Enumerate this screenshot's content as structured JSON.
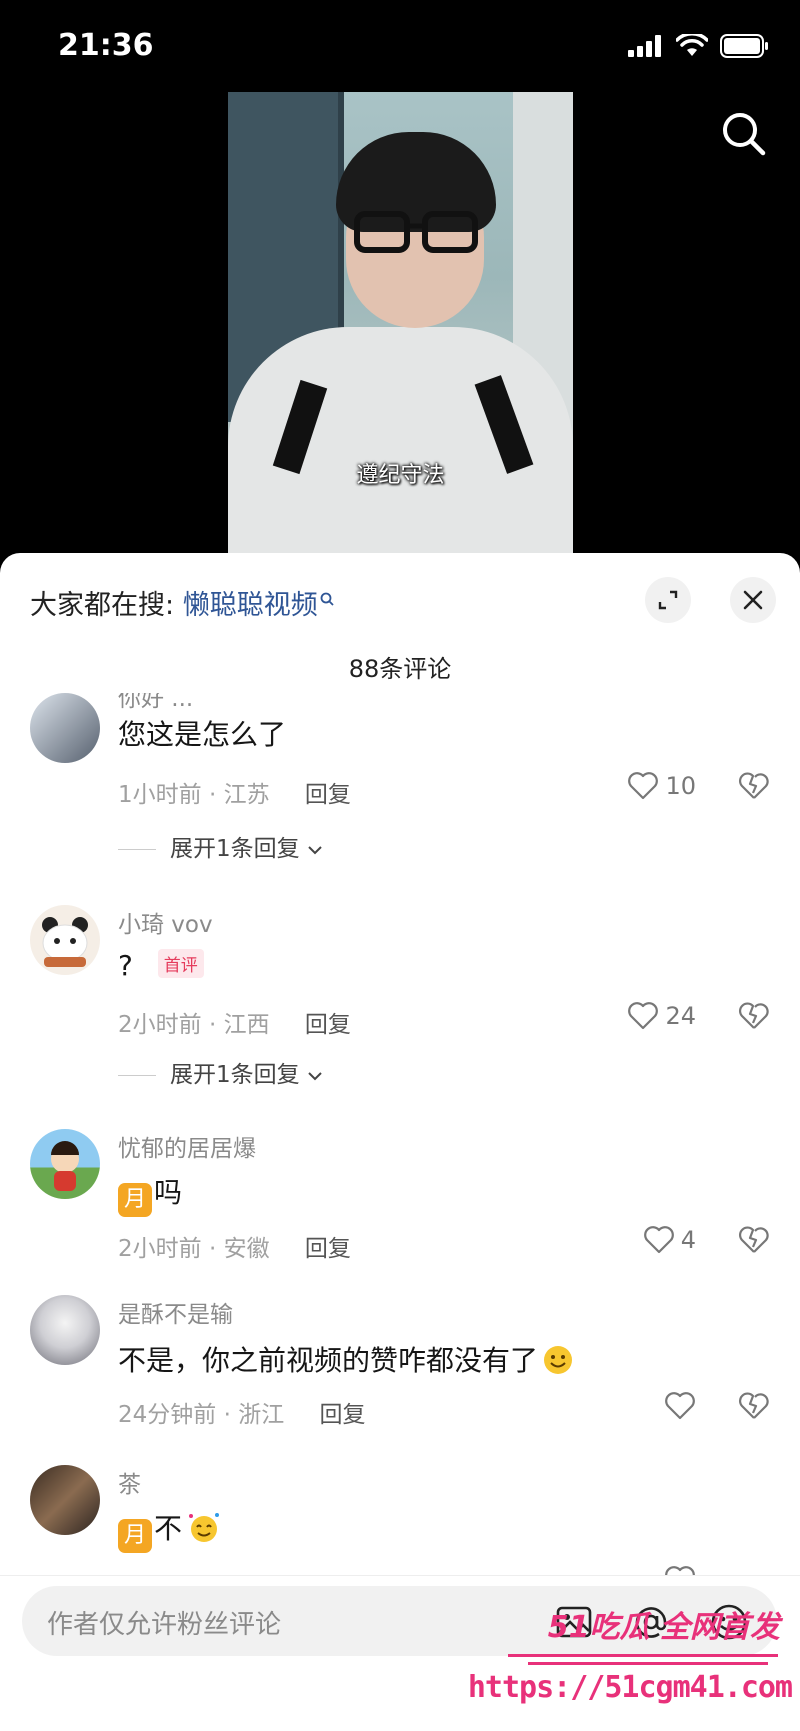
{
  "status_bar": {
    "time": "21:36"
  },
  "video": {
    "caption": "遵纪守法"
  },
  "sheet": {
    "hot_search_prefix": "大家都在搜:",
    "hot_search_keyword": "懒聪聪视频",
    "comment_count": "88条评论"
  },
  "comments": [
    {
      "name": "你好 ...",
      "text": "您这是怎么了",
      "time": "1小时前 · 江苏",
      "reply": "回复",
      "likes": "10",
      "expand": "展开1条回复"
    },
    {
      "name": "小琦 vov",
      "text": "?",
      "badge": "首评",
      "time": "2小时前 · 江西",
      "reply": "回复",
      "likes": "24",
      "expand": "展开1条回复"
    },
    {
      "name": "忧郁的居居爆",
      "emoji": "月",
      "text": "吗",
      "time": "2小时前 · 安徽",
      "reply": "回复",
      "likes": "4"
    },
    {
      "name": "是酥不是输",
      "text": "不是，你之前视频的赞咋都没有了",
      "time": "24分钟前 · 浙江",
      "reply": "回复",
      "likes": ""
    },
    {
      "name": "茶",
      "emoji": "月",
      "text": "不",
      "time": "",
      "reply": "",
      "likes": ""
    }
  ],
  "input": {
    "placeholder": "作者仅允许粉丝评论"
  },
  "watermark": {
    "top": "51吃瓜 全网首发",
    "url": "https://51cgm41.com"
  },
  "colors": {
    "accent_link": "#2f5595",
    "badge_red": "#e53b5c",
    "watermark": "#e8317a"
  }
}
